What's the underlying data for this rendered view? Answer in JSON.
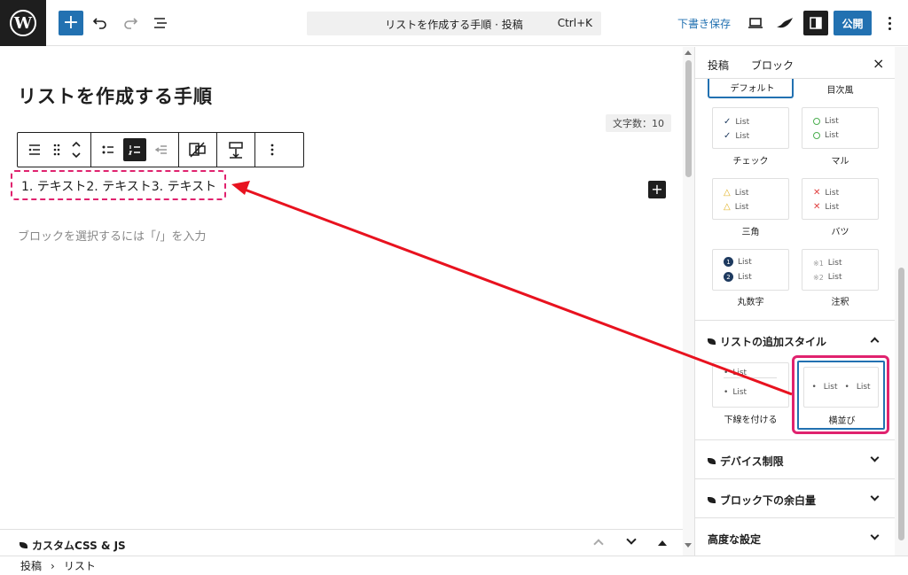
{
  "topbar": {
    "search_text": "リストを作成する手順 · 投稿",
    "shortcut": "Ctrl+K",
    "save_draft": "下書き保存",
    "publish": "公開",
    "add": "+"
  },
  "editor": {
    "title": "リストを作成する手順",
    "word_count": "文字数：10",
    "list_text": "1. テキスト2. テキスト3. テキスト",
    "placeholder": "ブロックを選択するには「/」を入力"
  },
  "metabox": {
    "title": "カスタムCSS & JS"
  },
  "breadcrumb": {
    "items": [
      "投稿",
      "リスト"
    ],
    "separator": "›"
  },
  "sidebar": {
    "tabs": [
      "投稿",
      "ブロック"
    ],
    "close": "×",
    "styles": {
      "default_label": "デフォルト",
      "toc_label": "目次風",
      "item_text": "List",
      "check_label": "チェック",
      "circle_label": "マル",
      "triangle_label": "三角",
      "cross_label": "バツ",
      "number_label": "丸数字",
      "note_label": "注釈",
      "note_prefix_1": "※1",
      "note_prefix_2": "※2",
      "num_1": "1",
      "num_2": "2"
    },
    "extra_styles": {
      "title": "リストの追加スタイル",
      "underline_label": "下線を付ける",
      "horizontal_label": "横並び"
    },
    "sections": {
      "device": "デバイス制限",
      "margin": "ブロック下の余白量",
      "advanced": "高度な設定"
    }
  },
  "colors": {
    "accent": "#2271b1",
    "highlight": "#e0226e",
    "arrow": "#e8121f",
    "dark": "#1e1e1e",
    "check": "#1e3a5f",
    "circle": "#4caf50",
    "triangle": "#e0b020",
    "cross": "#e04040"
  }
}
